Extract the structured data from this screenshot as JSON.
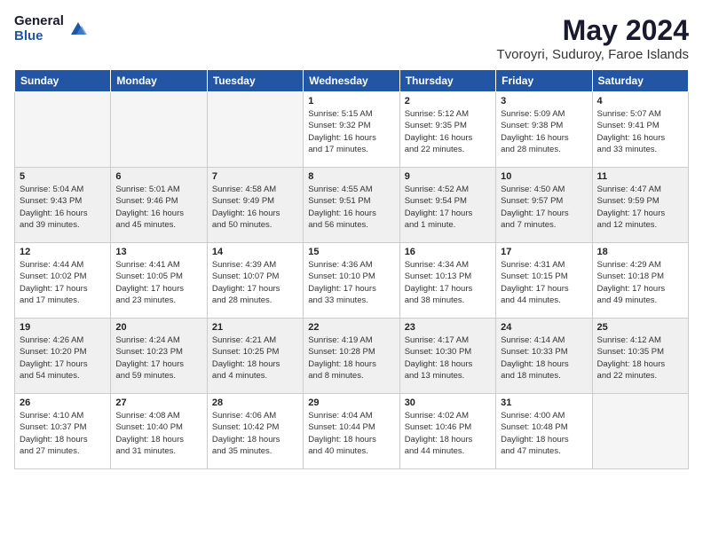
{
  "logo": {
    "general": "General",
    "blue": "Blue"
  },
  "title": "May 2024",
  "subtitle": "Tvoroyri, Suduroy, Faroe Islands",
  "days_header": [
    "Sunday",
    "Monday",
    "Tuesday",
    "Wednesday",
    "Thursday",
    "Friday",
    "Saturday"
  ],
  "weeks": [
    [
      {
        "num": "",
        "info": ""
      },
      {
        "num": "",
        "info": ""
      },
      {
        "num": "",
        "info": ""
      },
      {
        "num": "1",
        "info": "Sunrise: 5:15 AM\nSunset: 9:32 PM\nDaylight: 16 hours\nand 17 minutes."
      },
      {
        "num": "2",
        "info": "Sunrise: 5:12 AM\nSunset: 9:35 PM\nDaylight: 16 hours\nand 22 minutes."
      },
      {
        "num": "3",
        "info": "Sunrise: 5:09 AM\nSunset: 9:38 PM\nDaylight: 16 hours\nand 28 minutes."
      },
      {
        "num": "4",
        "info": "Sunrise: 5:07 AM\nSunset: 9:41 PM\nDaylight: 16 hours\nand 33 minutes."
      }
    ],
    [
      {
        "num": "5",
        "info": "Sunrise: 5:04 AM\nSunset: 9:43 PM\nDaylight: 16 hours\nand 39 minutes."
      },
      {
        "num": "6",
        "info": "Sunrise: 5:01 AM\nSunset: 9:46 PM\nDaylight: 16 hours\nand 45 minutes."
      },
      {
        "num": "7",
        "info": "Sunrise: 4:58 AM\nSunset: 9:49 PM\nDaylight: 16 hours\nand 50 minutes."
      },
      {
        "num": "8",
        "info": "Sunrise: 4:55 AM\nSunset: 9:51 PM\nDaylight: 16 hours\nand 56 minutes."
      },
      {
        "num": "9",
        "info": "Sunrise: 4:52 AM\nSunset: 9:54 PM\nDaylight: 17 hours\nand 1 minute."
      },
      {
        "num": "10",
        "info": "Sunrise: 4:50 AM\nSunset: 9:57 PM\nDaylight: 17 hours\nand 7 minutes."
      },
      {
        "num": "11",
        "info": "Sunrise: 4:47 AM\nSunset: 9:59 PM\nDaylight: 17 hours\nand 12 minutes."
      }
    ],
    [
      {
        "num": "12",
        "info": "Sunrise: 4:44 AM\nSunset: 10:02 PM\nDaylight: 17 hours\nand 17 minutes."
      },
      {
        "num": "13",
        "info": "Sunrise: 4:41 AM\nSunset: 10:05 PM\nDaylight: 17 hours\nand 23 minutes."
      },
      {
        "num": "14",
        "info": "Sunrise: 4:39 AM\nSunset: 10:07 PM\nDaylight: 17 hours\nand 28 minutes."
      },
      {
        "num": "15",
        "info": "Sunrise: 4:36 AM\nSunset: 10:10 PM\nDaylight: 17 hours\nand 33 minutes."
      },
      {
        "num": "16",
        "info": "Sunrise: 4:34 AM\nSunset: 10:13 PM\nDaylight: 17 hours\nand 38 minutes."
      },
      {
        "num": "17",
        "info": "Sunrise: 4:31 AM\nSunset: 10:15 PM\nDaylight: 17 hours\nand 44 minutes."
      },
      {
        "num": "18",
        "info": "Sunrise: 4:29 AM\nSunset: 10:18 PM\nDaylight: 17 hours\nand 49 minutes."
      }
    ],
    [
      {
        "num": "19",
        "info": "Sunrise: 4:26 AM\nSunset: 10:20 PM\nDaylight: 17 hours\nand 54 minutes."
      },
      {
        "num": "20",
        "info": "Sunrise: 4:24 AM\nSunset: 10:23 PM\nDaylight: 17 hours\nand 59 minutes."
      },
      {
        "num": "21",
        "info": "Sunrise: 4:21 AM\nSunset: 10:25 PM\nDaylight: 18 hours\nand 4 minutes."
      },
      {
        "num": "22",
        "info": "Sunrise: 4:19 AM\nSunset: 10:28 PM\nDaylight: 18 hours\nand 8 minutes."
      },
      {
        "num": "23",
        "info": "Sunrise: 4:17 AM\nSunset: 10:30 PM\nDaylight: 18 hours\nand 13 minutes."
      },
      {
        "num": "24",
        "info": "Sunrise: 4:14 AM\nSunset: 10:33 PM\nDaylight: 18 hours\nand 18 minutes."
      },
      {
        "num": "25",
        "info": "Sunrise: 4:12 AM\nSunset: 10:35 PM\nDaylight: 18 hours\nand 22 minutes."
      }
    ],
    [
      {
        "num": "26",
        "info": "Sunrise: 4:10 AM\nSunset: 10:37 PM\nDaylight: 18 hours\nand 27 minutes."
      },
      {
        "num": "27",
        "info": "Sunrise: 4:08 AM\nSunset: 10:40 PM\nDaylight: 18 hours\nand 31 minutes."
      },
      {
        "num": "28",
        "info": "Sunrise: 4:06 AM\nSunset: 10:42 PM\nDaylight: 18 hours\nand 35 minutes."
      },
      {
        "num": "29",
        "info": "Sunrise: 4:04 AM\nSunset: 10:44 PM\nDaylight: 18 hours\nand 40 minutes."
      },
      {
        "num": "30",
        "info": "Sunrise: 4:02 AM\nSunset: 10:46 PM\nDaylight: 18 hours\nand 44 minutes."
      },
      {
        "num": "31",
        "info": "Sunrise: 4:00 AM\nSunset: 10:48 PM\nDaylight: 18 hours\nand 47 minutes."
      },
      {
        "num": "",
        "info": ""
      }
    ]
  ]
}
